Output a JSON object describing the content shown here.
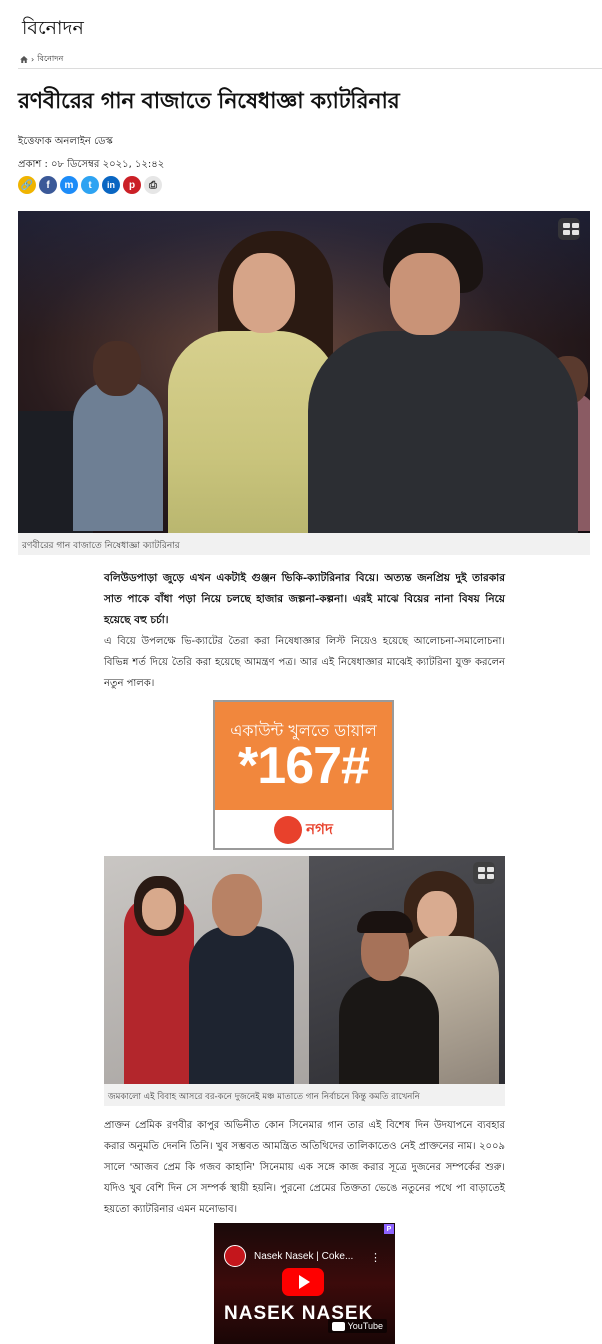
{
  "section": {
    "title": "বিনোদন"
  },
  "breadcrumb": {
    "home_icon": "home-icon",
    "separator": "›",
    "current": "বিনোদন"
  },
  "article": {
    "headline": "রণবীরের গান বাজাতে নিষেধাজ্ঞা ক্যাটরিনার",
    "author": "ইত্তেফাক অনলাইন ডেস্ক",
    "published": "প্রকাশ : ০৮ ডিসেম্বর ২০২১, ১২:৪২",
    "share_buttons": [
      {
        "name": "copy-link-icon",
        "glyph": "🔗",
        "color": "#f0b400"
      },
      {
        "name": "facebook-icon",
        "glyph": "f",
        "color": "#3b5998"
      },
      {
        "name": "messenger-icon",
        "glyph": "m",
        "color": "#1d8cf8"
      },
      {
        "name": "twitter-icon",
        "glyph": "t",
        "color": "#2ea3f2"
      },
      {
        "name": "linkedin-icon",
        "glyph": "in",
        "color": "#0a66c2"
      },
      {
        "name": "pinterest-icon",
        "glyph": "p",
        "color": "#cb2027"
      },
      {
        "name": "print-icon",
        "glyph": "⎙",
        "color": "#e6e6e6"
      }
    ],
    "hero_caption": "রণবীরের গান বাজাতে নিষেধাজ্ঞা ক্যাটরিনার",
    "lead": "বলিউডপাড়া জুড়ে এখন একটাই গুঞ্জন ভিকি-ক্যাটরিনার বিয়ে। অত্যন্ত জনপ্রিয় দুই তারকার সাত পাকে বাঁধা পড়া নিয়ে চলছে হাজার জল্পনা-কল্পনা। এরই মাঝে বিয়ের নানা বিষয় নিয়ে হয়েছে বহু চর্চা।",
    "paragraph1": "এ বিয়ে উপলক্ষে ভি-ক্যাটের তৈরা করা নিষেধাজ্ঞার লিস্ট নিয়েও হয়েছে আলোচনা-সমালোচনা। বিভিন্ন শর্ত দিয়ে তৈরি করা হয়েছে আমন্ত্রণ পত্র। আর এই নিষেধাজ্ঞার মাঝেই ক্যাটরিনা যুক্ত করলেন নতুন পালক।",
    "photo2_caption": "জমকালো এই বিবাহ আসরে বর-কনে দুজনেই মঞ্চ মাতাতে গান নির্বাচনে কিন্তু কমতি রাখেননি",
    "paragraph2": "প্রাক্তন প্রেমিক রণবীর কাপুর অভিনীত কোন সিনেমার গান তার এই বিশেষ দিন উদযাপনে ব্যবহার করার অনুমতি দেননি তিনি। খুব সম্ভবত আমন্ত্রিত অতিথিদের তালিকাতেও নেই প্রাক্তনের নাম। ২০০৯ সালে 'আজব প্রেম কি গজব কাহানি' সিনেমায় এক সঙ্গে কাজ করার সূত্রে দুজনের সম্পর্কের শুরু। যদিও খুব বেশি দিন সে সম্পর্ক স্থায়ী হয়নি। পুরনো প্রেমের তিক্ততা ভেঙে নতুনের পথে পা বাড়াতেই হয়তো ক্যাটরিনার এমন মনোভাব।"
  },
  "ad": {
    "line1": "একাউন্ট খুলতে ডায়াল",
    "code": "*167#",
    "brand": "নগদ"
  },
  "video": {
    "title": "Nasek Nasek | Coke...",
    "big_text": "NASEK NASEK",
    "platform": "YouTube",
    "adchoice": "P"
  }
}
